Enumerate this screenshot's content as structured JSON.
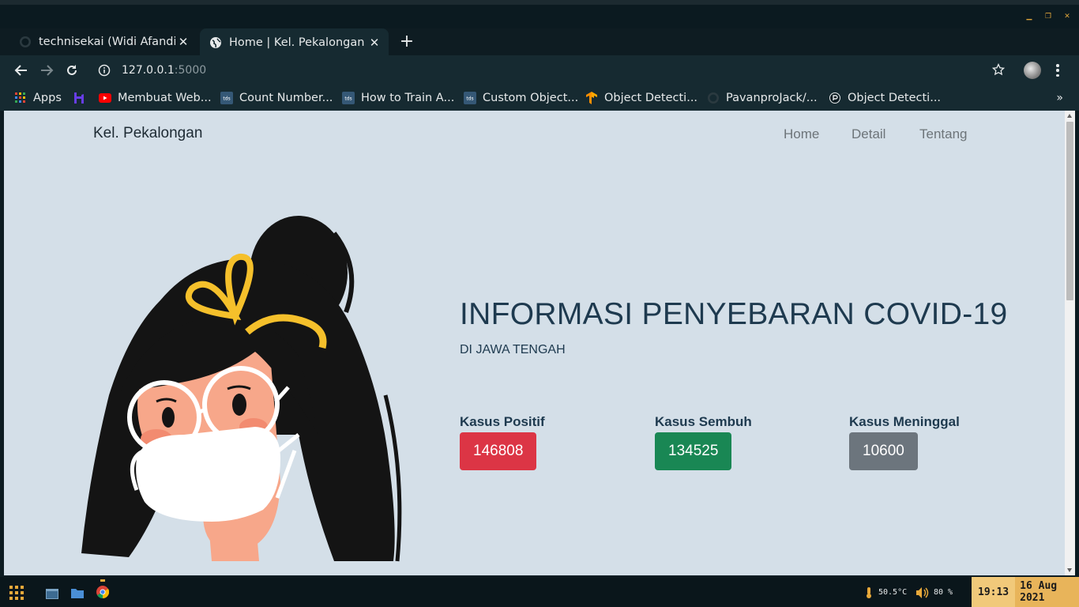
{
  "browser": {
    "tabs": [
      {
        "title": "technisekai (Widi Afandi)",
        "icon": "github-icon"
      },
      {
        "title": "Home | Kel. Pekalongan",
        "icon": "globe-icon",
        "active": true
      }
    ],
    "url_host": "127.0.0.1",
    "url_port": ":5000",
    "bookmarks": [
      {
        "label": "Apps",
        "icon": "apps-grid-icon"
      },
      {
        "label": "",
        "icon": "hostinger-icon"
      },
      {
        "label": "Membuat Web...",
        "icon": "youtube-icon"
      },
      {
        "label": "Count Number...",
        "icon": "tds-icon"
      },
      {
        "label": "How to Train A...",
        "icon": "tds-icon"
      },
      {
        "label": "Custom Object...",
        "icon": "tds-icon"
      },
      {
        "label": "Object Detecti...",
        "icon": "tensorflow-icon"
      },
      {
        "label": "PavanproJack/...",
        "icon": "github-icon"
      },
      {
        "label": "Object Detecti...",
        "icon": "site-icon"
      }
    ],
    "more": "»"
  },
  "page": {
    "brand": "Kel. Pekalongan",
    "nav": {
      "home": "Home",
      "detail": "Detail",
      "tentang": "Tentang"
    },
    "title": "INFORMASI PENYEBARAN COVID-19",
    "subtitle": "DI JAWA TENGAH",
    "stats": [
      {
        "label": "Kasus Positif",
        "value": "146808",
        "color": "#dc3545"
      },
      {
        "label": "Kasus Sembuh",
        "value": "134525",
        "color": "#198754"
      },
      {
        "label": "Kasus Meninggal",
        "value": "10600",
        "color": "#6c757d"
      }
    ]
  },
  "taskbar": {
    "temp": "50.5°C",
    "volume": "80 %",
    "time": "19:13",
    "date": "16 Aug 2021"
  },
  "colors": {
    "page_bg": "#d4dfe8",
    "heading": "#1e3a4f",
    "chrome_bg": "#162a31",
    "titlebar_bg": "#0b1a20"
  }
}
